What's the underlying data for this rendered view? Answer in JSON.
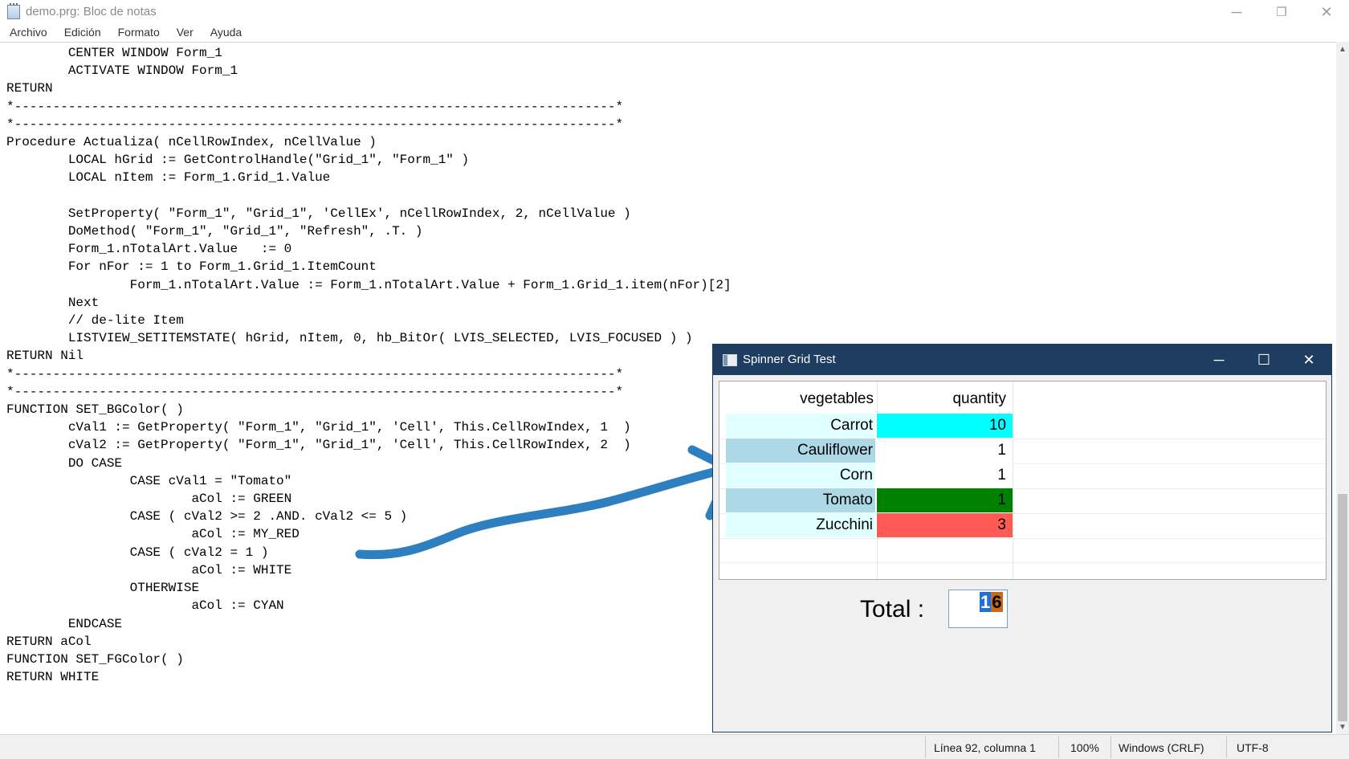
{
  "notepad": {
    "title": "demo.prg: Bloc de notas",
    "menu": [
      "Archivo",
      "Edición",
      "Formato",
      "Ver",
      "Ayuda"
    ],
    "code_lines": [
      "        CENTER WINDOW Form_1",
      "        ACTIVATE WINDOW Form_1",
      "RETURN",
      "*------------------------------------------------------------------------------*",
      "*------------------------------------------------------------------------------*",
      "Procedure Actualiza( nCellRowIndex, nCellValue )",
      "        LOCAL hGrid := GetControlHandle(\"Grid_1\", \"Form_1\" )",
      "        LOCAL nItem := Form_1.Grid_1.Value",
      "",
      "        SetProperty( \"Form_1\", \"Grid_1\", 'CellEx', nCellRowIndex, 2, nCellValue )",
      "        DoMethod( \"Form_1\", \"Grid_1\", \"Refresh\", .T. )",
      "        Form_1.nTotalArt.Value   := 0",
      "        For nFor := 1 to Form_1.Grid_1.ItemCount",
      "                Form_1.nTotalArt.Value := Form_1.nTotalArt.Value + Form_1.Grid_1.item(nFor)[2]",
      "        Next",
      "        // de-lite Item",
      "        LISTVIEW_SETITEMSTATE( hGrid, nItem, 0, hb_BitOr( LVIS_SELECTED, LVIS_FOCUSED ) )",
      "RETURN Nil",
      "*------------------------------------------------------------------------------*",
      "*------------------------------------------------------------------------------*",
      "FUNCTION SET_BGColor( )",
      "        cVal1 := GetProperty( \"Form_1\", \"Grid_1\", 'Cell', This.CellRowIndex, 1  )",
      "        cVal2 := GetProperty( \"Form_1\", \"Grid_1\", 'Cell', This.CellRowIndex, 2  )",
      "        DO CASE",
      "                CASE cVal1 = \"Tomato\"",
      "                        aCol := GREEN",
      "                CASE ( cVal2 >= 2 .AND. cVal2 <= 5 )",
      "                        aCol := MY_RED",
      "                CASE ( cVal2 = 1 )",
      "                        aCol := WHITE",
      "                OTHERWISE",
      "                        aCol := CYAN",
      "        ENDCASE",
      "RETURN aCol",
      "FUNCTION SET_FGColor( )",
      "RETURN WHITE"
    ],
    "status": {
      "position": "Línea 92, columna 1",
      "zoom": "100%",
      "line_endings": "Windows (CRLF)",
      "encoding": "UTF-8"
    },
    "window_controls": {
      "minimize": "─",
      "restore": "❐",
      "close": "✕"
    }
  },
  "spinner_window": {
    "title": "Spinner Grid Test",
    "window_controls": {
      "minimize": "─",
      "maximize": "☐",
      "close": "✕"
    },
    "columns": [
      "vegetables",
      "quantity"
    ],
    "rows": [
      {
        "vegetable": "Carrot",
        "quantity": "10",
        "name_bg": "#e0ffff",
        "qty_bg": "#00ffff",
        "qty_color": "#000000"
      },
      {
        "vegetable": "Cauliflower",
        "quantity": "1",
        "name_bg": "#add8e6",
        "qty_bg": "#ffffff",
        "qty_color": "#000000"
      },
      {
        "vegetable": "Corn",
        "quantity": "1",
        "name_bg": "#e0ffff",
        "qty_bg": "#ffffff",
        "qty_color": "#000000"
      },
      {
        "vegetable": "Tomato",
        "quantity": "1",
        "name_bg": "#add8e6",
        "qty_bg": "#008000",
        "qty_color": "#000000"
      },
      {
        "vegetable": "Zucchini",
        "quantity": "3",
        "name_bg": "#e0ffff",
        "qty_bg": "#ff5a55",
        "qty_color": "#000000"
      }
    ],
    "total_label": "Total :",
    "total_value": {
      "first": "1",
      "second": "6"
    }
  },
  "annotation": {
    "arrow_color": "#2e7fc0"
  }
}
